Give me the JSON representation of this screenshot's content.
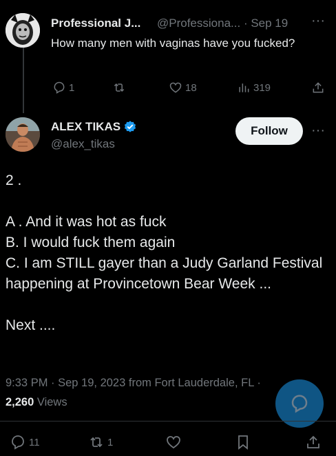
{
  "reply": {
    "display_name": "Professional J...",
    "handle": "@Professiona...",
    "date": "· Sep 19",
    "more": "···",
    "text": "How many men with vaginas have you fucked?",
    "replies": "1",
    "reposts": "",
    "likes": "18",
    "views": "319"
  },
  "main": {
    "display_name": "ALEX TIKAS",
    "handle": "@alex_tikas",
    "follow_label": "Follow",
    "more": "···",
    "body": "2 .\n\nA . And it was hot as fuck\nB.  I would fuck them again\nC. I am STILL gayer than a Judy Garland Festival happening at Provincetown Bear Week ...\n\nNext ....",
    "meta_time": "9:33 PM · Sep 19, 2023 from Fort Lauderdale, FL · ",
    "views_count": "2,260",
    "views_label": " Views",
    "replies": "11",
    "reposts": "1"
  },
  "colors": {
    "background": "#000000",
    "text": "#e7e9ea",
    "muted": "#71767b",
    "verified": "#1d9bf0",
    "follow_bg": "#eff3f4"
  },
  "icons": [
    "reply-icon",
    "repost-icon",
    "like-icon",
    "views-icon",
    "share-icon",
    "bookmark-icon",
    "verified-badge-icon",
    "compose-icon"
  ]
}
